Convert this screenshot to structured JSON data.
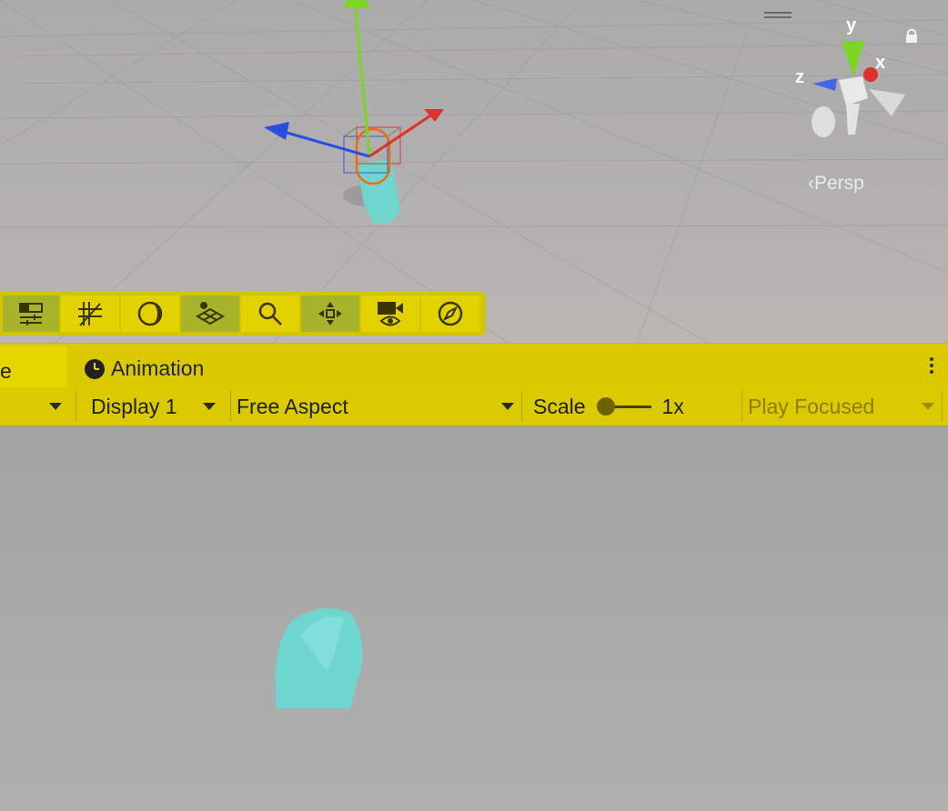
{
  "scene": {
    "persp_label": "Persp",
    "gizmo_axes": {
      "x": "x",
      "y": "y",
      "z": "z"
    },
    "colors": {
      "x_axis": "#e0302a",
      "y_axis": "#7cd621",
      "z_axis": "#2a4de0",
      "selection": "#f06a10",
      "object": "#68d6cf"
    }
  },
  "overlay_toolbar": {
    "buttons": [
      {
        "icon": "tool-settings-icon",
        "active": true
      },
      {
        "icon": "grid-snapping-icon",
        "active": false
      },
      {
        "icon": "lighting-toggle-icon",
        "active": false
      },
      {
        "icon": "scene-visibility-icon",
        "active": true
      },
      {
        "icon": "search-icon",
        "active": false
      },
      {
        "icon": "move-tool-icon",
        "active": true
      },
      {
        "icon": "camera-view-icon",
        "active": false
      },
      {
        "icon": "compass-icon",
        "active": false
      }
    ],
    "accent": "#d3c400"
  },
  "tabs": {
    "active_partial": "e",
    "animation": "Animation"
  },
  "game_toolbar": {
    "display": "Display 1",
    "aspect": "Free Aspect",
    "scale_label": "Scale",
    "scale_value": "1x",
    "scale_level": 0.05,
    "play_mode": "Play Focused"
  }
}
